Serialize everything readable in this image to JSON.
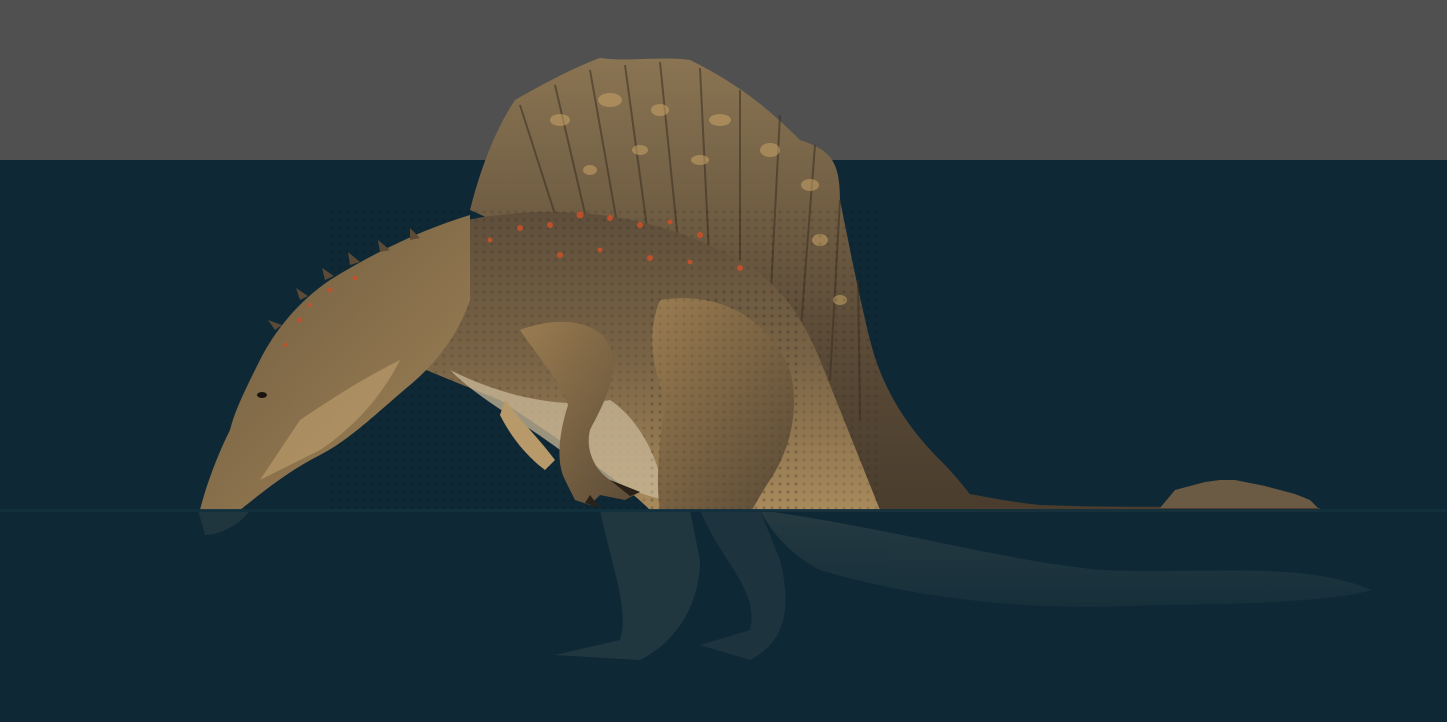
{
  "viewport": {
    "colors": {
      "background_top": "#505050",
      "water": "#0f2835",
      "water_surface": "#12303e",
      "skin_base": "#6e5a3e",
      "skin_light": "#b8955e",
      "skin_dark": "#3f3426",
      "sail_base": "#6a5a44",
      "belly": "#c9b898",
      "spots_accent": "#c8502a",
      "submerged_tint": "#1c3a47"
    },
    "model": {
      "subject_icon": "spinosaurus-model-icon"
    }
  }
}
